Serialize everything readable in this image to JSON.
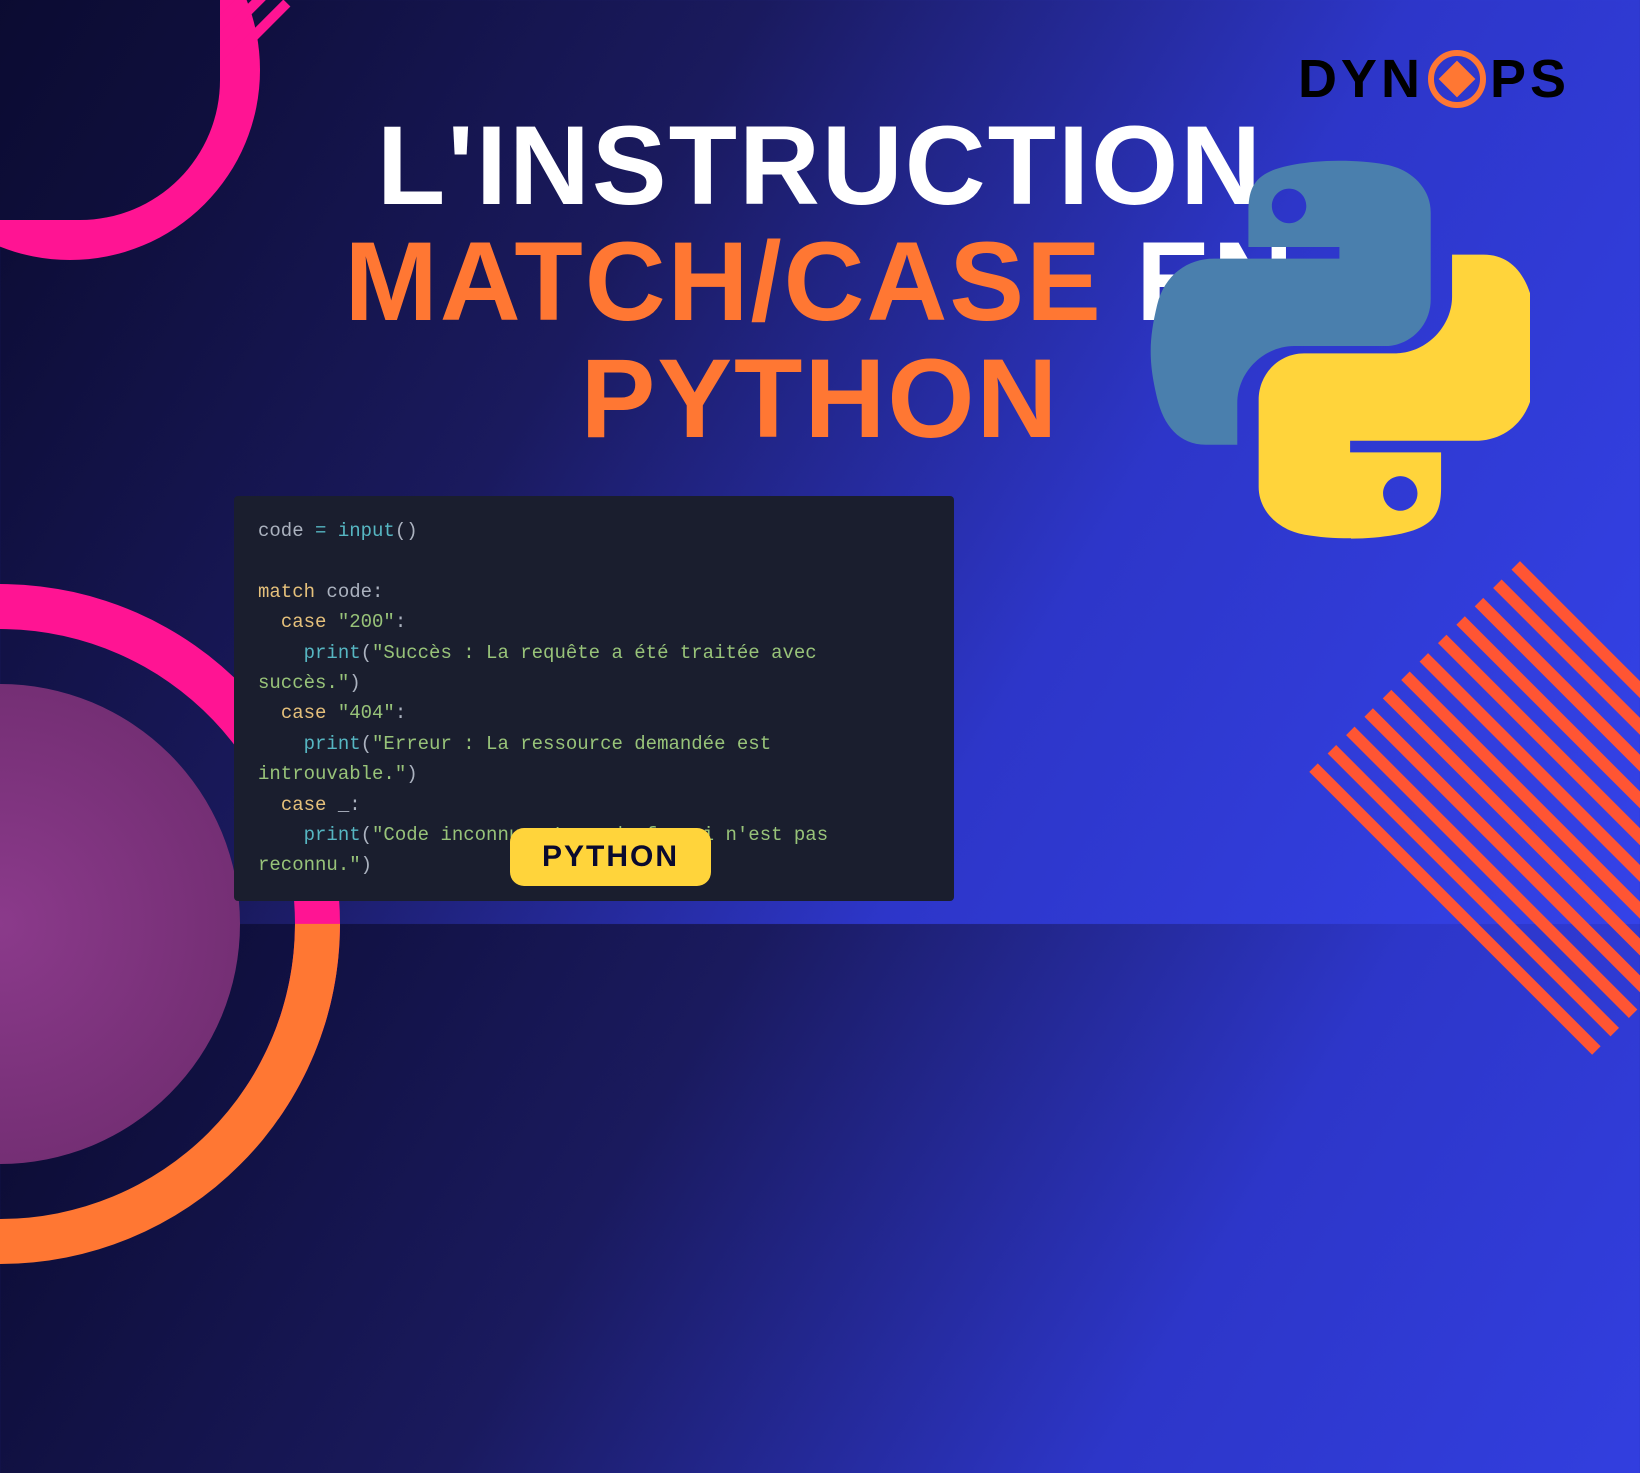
{
  "brand": {
    "part1": "DYN",
    "part2": "PS",
    "icon_name": "dynops-diamond-icon"
  },
  "title": {
    "line1": "L'INSTRUCTION",
    "line2_orange": "MATCH/CASE",
    "line2_white": "EN",
    "line3": "PYTHON"
  },
  "code": {
    "l1_var": "code",
    "l1_op": "=",
    "l1_fn": "input",
    "l1_paren": "()",
    "l3_kw": "match",
    "l3_var": "code",
    "l3_colon": ":",
    "l4_kw": "case",
    "l4_str": "\"200\"",
    "l4_colon": ":",
    "l5_fn": "print",
    "l5_l": "(",
    "l5_str": "\"Succès : La requête a été traitée avec succès.\"",
    "l5_r": ")",
    "l6_kw": "case",
    "l6_str": "\"404\"",
    "l6_colon": ":",
    "l7_fn": "print",
    "l7_l": "(",
    "l7_str": "\"Erreur : La ressource demandée est introuvable.\"",
    "l7_r": ")",
    "l8_kw": "case",
    "l8_wild": "_",
    "l8_colon": ":",
    "l9_fn": "print",
    "l9_l": "(",
    "l9_str": "\"Code inconnu : Le code fourni n'est pas reconnu.\"",
    "l9_r": ")"
  },
  "badge": {
    "label": "PYTHON"
  },
  "colors": {
    "orange": "#ff7733",
    "pink": "#ff1493",
    "yellow": "#ffd43b"
  }
}
